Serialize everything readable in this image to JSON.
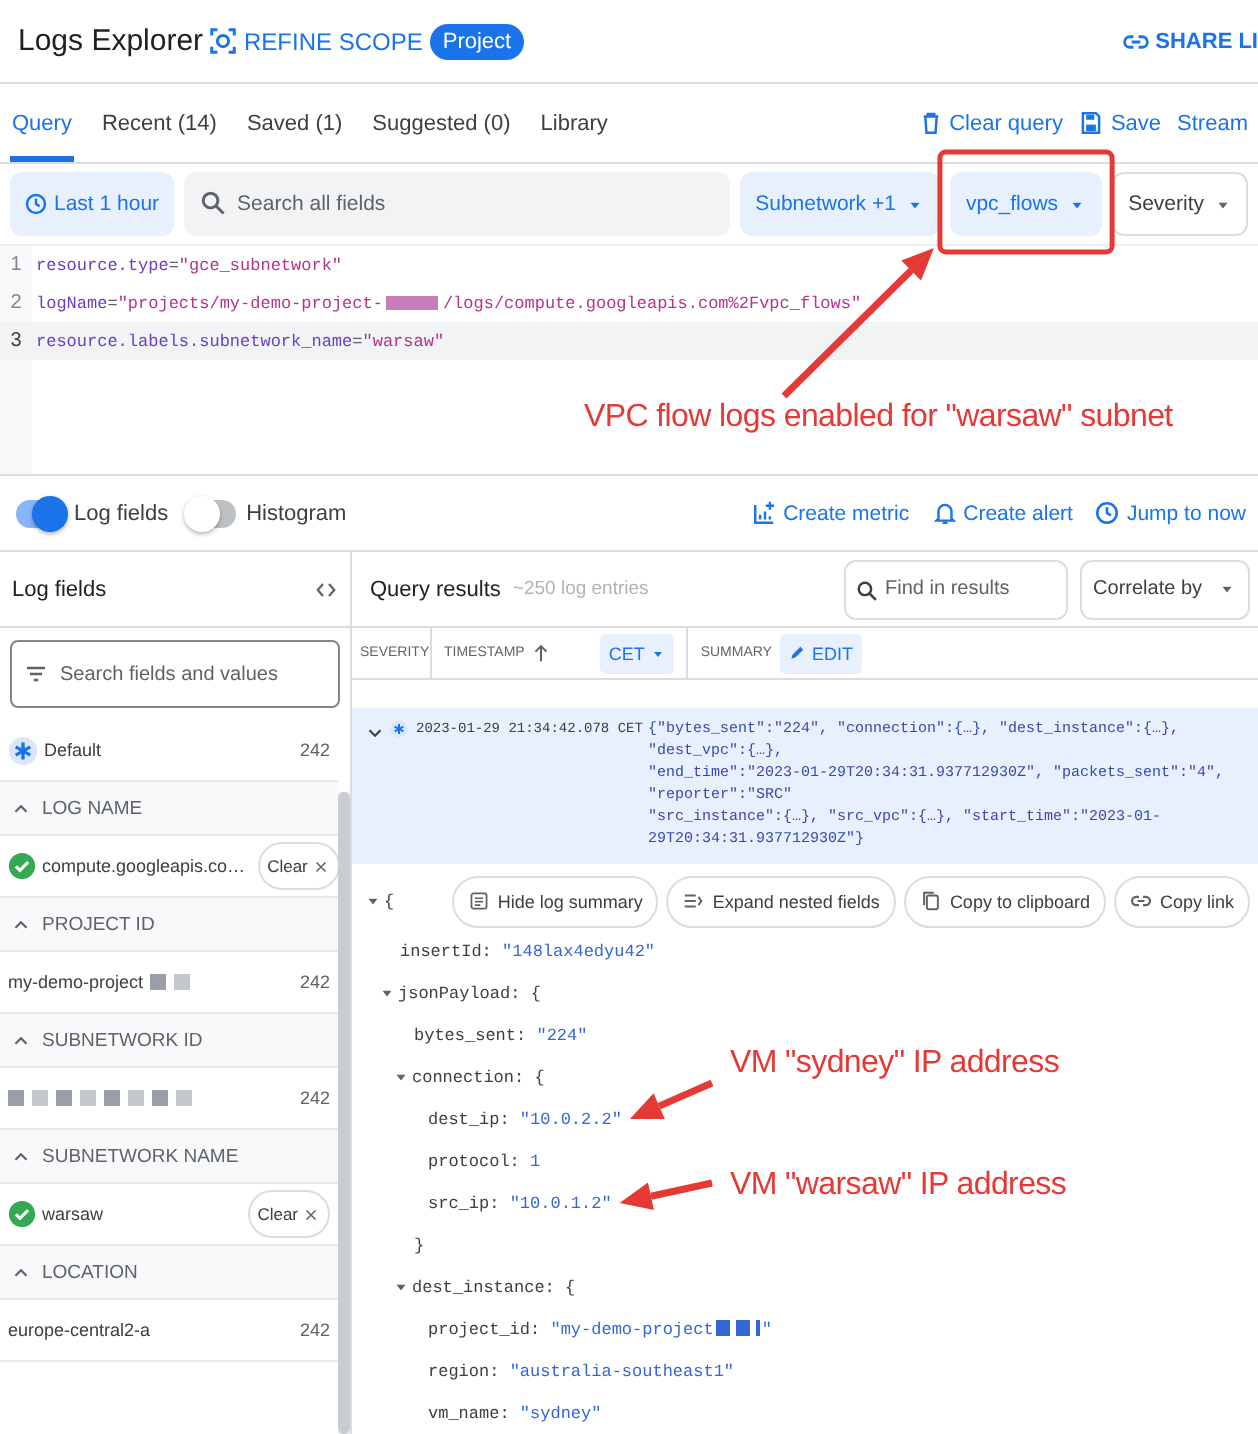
{
  "header": {
    "title": "Logs Explorer",
    "scope_label": "REFINE SCOPE",
    "scope_chip": "Project",
    "share": "SHARE LI"
  },
  "tabs": [
    {
      "label": "Query",
      "selected": true
    },
    {
      "label": "Recent (14)",
      "selected": false
    },
    {
      "label": "Saved (1)",
      "selected": false
    },
    {
      "label": "Suggested (0)",
      "selected": false
    },
    {
      "label": "Library",
      "selected": false
    }
  ],
  "query_actions": [
    {
      "kind": "clear",
      "label": "Clear query"
    },
    {
      "kind": "save",
      "label": "Save"
    },
    {
      "kind": "stream",
      "label": "Stream"
    }
  ],
  "filters": {
    "time_range": "Last 1 hour",
    "search": {
      "placeholder": "Search all fields"
    },
    "dropdowns": [
      {
        "label": "Subnetwork +1",
        "active": true
      },
      {
        "label": "vpc_flows",
        "active": true
      },
      {
        "label": "Severity",
        "active": false
      }
    ]
  },
  "editor": {
    "lines": [
      {
        "number": "1",
        "current": false,
        "segments": [
          {
            "kind": "field",
            "text": "resource.type"
          },
          {
            "kind": "op",
            "text": "="
          },
          {
            "kind": "value",
            "text": "\"gce_subnetwork\""
          }
        ]
      },
      {
        "number": "2",
        "current": false,
        "segments": [
          {
            "kind": "field",
            "text": "logName"
          },
          {
            "kind": "op",
            "text": "="
          },
          {
            "kind": "value",
            "text": "\"projects/my-demo-project-"
          },
          {
            "kind": "redacted"
          },
          {
            "kind": "value",
            "text": "/logs/compute.googleapis.com%2Fvpc_flows\""
          }
        ]
      },
      {
        "number": "3",
        "current": true,
        "segments": [
          {
            "kind": "field",
            "text": "resource.labels.subnetwork_name"
          },
          {
            "kind": "op",
            "text": "="
          },
          {
            "kind": "value",
            "text": "\"warsaw\""
          }
        ]
      }
    ]
  },
  "view_toggles": [
    {
      "label": "Log fields",
      "on": true
    },
    {
      "label": "Histogram",
      "on": false
    }
  ],
  "result_actions": [
    {
      "kind": "metric",
      "label": "Create metric"
    },
    {
      "kind": "alert",
      "label": "Create alert"
    },
    {
      "kind": "jump",
      "label": "Jump to now"
    }
  ],
  "log_fields": {
    "title": "Log fields",
    "search": {
      "placeholder": "Search fields and values"
    },
    "default": {
      "label": "Default",
      "count": "242"
    },
    "groups": [
      {
        "heading": "LOG NAME",
        "expanded": true,
        "items": [
          {
            "label": "compute.googleapis.co…",
            "checked": true,
            "redacted": false,
            "clear": "Clear"
          }
        ]
      },
      {
        "heading": "PROJECT ID",
        "expanded": true,
        "items": [
          {
            "label": "my-demo-project",
            "checked": false,
            "redacted": true,
            "count": "242"
          }
        ]
      },
      {
        "heading": "SUBNETWORK ID",
        "expanded": true,
        "items": [
          {
            "checked": false,
            "redacted": true,
            "count": "242"
          }
        ]
      },
      {
        "heading": "SUBNETWORK NAME",
        "expanded": true,
        "items": [
          {
            "label": "warsaw",
            "checked": true,
            "redacted": false,
            "clear": "Clear"
          }
        ]
      },
      {
        "heading": "LOCATION",
        "expanded": true,
        "items": [
          {
            "label": "europe-central2-a",
            "checked": false,
            "redacted": false,
            "count": "242"
          }
        ]
      }
    ]
  },
  "results": {
    "title": "Query results",
    "count": "~250 log entries",
    "find": {
      "placeholder": "Find in results"
    },
    "correlate": "Correlate by",
    "columns": [
      {
        "label": "SEVERITY",
        "kind": "plain"
      },
      {
        "label": "TIMESTAMP",
        "kind": "sort"
      },
      {
        "label": "CET",
        "kind": "dropdown"
      },
      {
        "label": "SUMMARY",
        "kind": "plain"
      },
      {
        "label": "EDIT",
        "kind": "edit"
      }
    ],
    "entries": [
      {
        "expanded": true,
        "timestamp": "2023-01-29 21:34:42.078 CET",
        "summary": [
          "{\"bytes_sent\":\"224\", \"connection\":{…}, \"dest_instance\":{…}, \"dest_vpc\":{…},",
          "\"end_time\":\"2023-01-29T20:34:31.937712930Z\", \"packets_sent\":\"4\", \"reporter\":\"SRC\"",
          "\"src_instance\":{…}, \"src_vpc\":{…}, \"start_time\":\"2023-01-29T20:34:31.937712930Z\"}"
        ],
        "actions": [
          {
            "kind": "hide",
            "label": "Hide log summary"
          },
          {
            "kind": "expand",
            "label": "Expand nested fields"
          },
          {
            "kind": "copy",
            "label": "Copy to clipboard"
          },
          {
            "kind": "link",
            "label": "Copy link"
          }
        ],
        "tree": {
          "brace": "{",
          "expanded": true,
          "children": [
            {
              "key": "insertId:",
              "value": [
                {
                  "kind": "string",
                  "text": "\"148lax4edyu42\""
                }
              ]
            },
            {
              "key": "jsonPayload:",
              "brace": "{",
              "expanded": true,
              "children": [
                {
                  "key": "bytes_sent:",
                  "value": [
                    {
                      "kind": "string",
                      "text": "\"224\""
                    }
                  ]
                },
                {
                  "key": "connection:",
                  "brace": "{",
                  "expanded": true,
                  "closing": "}",
                  "children": [
                    {
                      "key": "dest_ip:",
                      "value": [
                        {
                          "kind": "string",
                          "text": "\"10.0.2.2\""
                        }
                      ]
                    },
                    {
                      "key": "protocol:",
                      "value": [
                        {
                          "kind": "number",
                          "text": "1"
                        }
                      ]
                    },
                    {
                      "key": "src_ip:",
                      "value": [
                        {
                          "kind": "string",
                          "text": "\"10.0.1.2\""
                        }
                      ]
                    }
                  ]
                },
                {
                  "key": "dest_instance:",
                  "brace": "{",
                  "expanded": true,
                  "children": [
                    {
                      "key": "project_id:",
                      "value": [
                        {
                          "kind": "string",
                          "text": "\"my-demo-project"
                        },
                        {
                          "kind": "redacted"
                        },
                        {
                          "kind": "string",
                          "text": "\""
                        }
                      ]
                    },
                    {
                      "key": "region:",
                      "value": [
                        {
                          "kind": "string",
                          "text": "\"australia-southeast1\""
                        }
                      ]
                    },
                    {
                      "key": "vm_name:",
                      "value": [
                        {
                          "kind": "string",
                          "text": "\"sydney\""
                        }
                      ]
                    }
                  ]
                }
              ]
            }
          ]
        }
      }
    ]
  },
  "annotations": [
    {
      "kind": "box"
    },
    {
      "kind": "callout",
      "text": "VPC flow logs enabled for \"warsaw\" subnet"
    },
    {
      "kind": "callout",
      "text": "VM \"sydney\" IP address"
    },
    {
      "kind": "callout",
      "text": "VM \"warsaw\" IP address"
    }
  ]
}
